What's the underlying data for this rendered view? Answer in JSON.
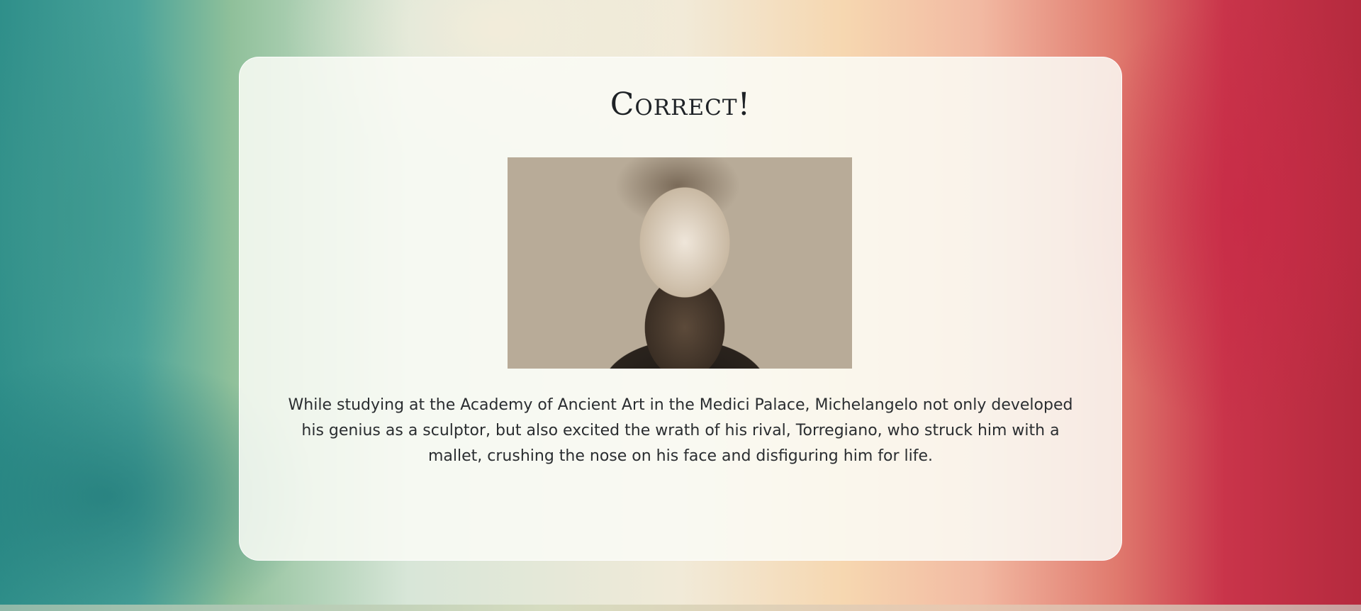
{
  "result": {
    "title": "Correct!",
    "image_alt": "Portrait of Michelangelo",
    "fact": "While studying at the Academy of Ancient Art in the Medici Palace, Michelangelo not only developed his genius as a sculptor, but also excited the wrath of his rival, Torregiano, who struck him with a mallet, crushing the nose on his face and disfiguring him for life."
  }
}
